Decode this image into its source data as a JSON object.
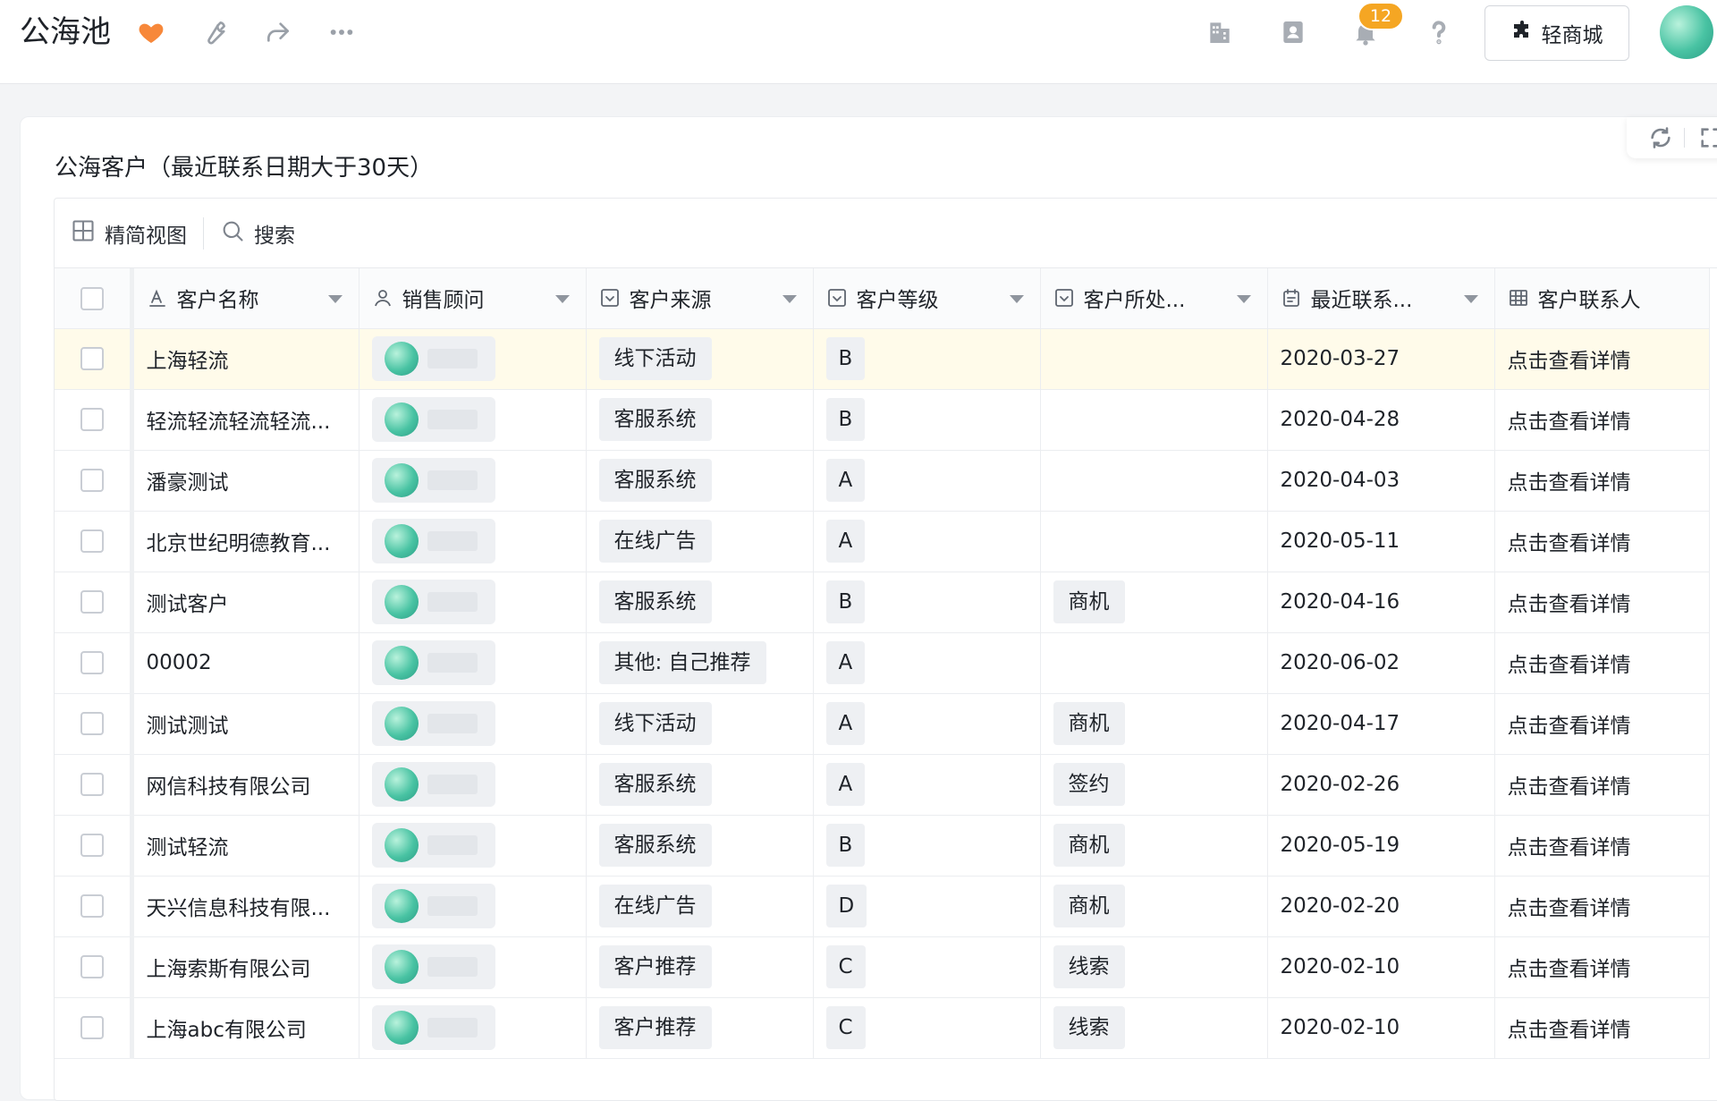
{
  "header": {
    "title": "公海池",
    "notification_count": "12",
    "shop_label": "轻商城"
  },
  "card": {
    "title": "公海客户（最近联系日期大于30天）"
  },
  "toolbar": {
    "view_label": "精简视图",
    "search_label": "搜索"
  },
  "table": {
    "columns": [
      {
        "label": "客户名称",
        "icon": "text-field-icon"
      },
      {
        "label": "销售顾问",
        "icon": "person-field-icon"
      },
      {
        "label": "客户来源",
        "icon": "select-field-icon"
      },
      {
        "label": "客户等级",
        "icon": "select-field-icon"
      },
      {
        "label": "客户所处...",
        "icon": "select-field-icon"
      },
      {
        "label": "最近联系...",
        "icon": "date-field-icon"
      },
      {
        "label": "客户联系人",
        "icon": "table-field-icon"
      }
    ],
    "rows": [
      {
        "name": "上海轻流",
        "source": "线下活动",
        "grade": "B",
        "stage": "",
        "date": "2020-03-27",
        "contact": "点击查看详情"
      },
      {
        "name": "轻流轻流轻流轻流...",
        "source": "客服系统",
        "grade": "B",
        "stage": "",
        "date": "2020-04-28",
        "contact": "点击查看详情"
      },
      {
        "name": "潘豪测试",
        "source": "客服系统",
        "grade": "A",
        "stage": "",
        "date": "2020-04-03",
        "contact": "点击查看详情"
      },
      {
        "name": "北京世纪明德教育...",
        "source": "在线广告",
        "grade": "A",
        "stage": "",
        "date": "2020-05-11",
        "contact": "点击查看详情"
      },
      {
        "name": "测试客户",
        "source": "客服系统",
        "grade": "B",
        "stage": "商机",
        "date": "2020-04-16",
        "contact": "点击查看详情"
      },
      {
        "name": "00002",
        "source": "其他: 自己推荐",
        "grade": "A",
        "stage": "",
        "date": "2020-06-02",
        "contact": "点击查看详情"
      },
      {
        "name": "测试测试",
        "source": "线下活动",
        "grade": "A",
        "stage": "商机",
        "date": "2020-04-17",
        "contact": "点击查看详情"
      },
      {
        "name": "网信科技有限公司",
        "source": "客服系统",
        "grade": "A",
        "stage": "签约",
        "date": "2020-02-26",
        "contact": "点击查看详情"
      },
      {
        "name": "测试轻流",
        "source": "客服系统",
        "grade": "B",
        "stage": "商机",
        "date": "2020-05-19",
        "contact": "点击查看详情"
      },
      {
        "name": "天兴信息科技有限...",
        "source": "在线广告",
        "grade": "D",
        "stage": "商机",
        "date": "2020-02-20",
        "contact": "点击查看详情"
      },
      {
        "name": "上海索斯有限公司",
        "source": "客户推荐",
        "grade": "C",
        "stage": "线索",
        "date": "2020-02-10",
        "contact": "点击查看详情"
      },
      {
        "name": "上海abc有限公司",
        "source": "客户推荐",
        "grade": "C",
        "stage": "线索",
        "date": "2020-02-10",
        "contact": "点击查看详情"
      }
    ]
  },
  "colors": {
    "accent_heart": "#f7883a",
    "badge": "#f5a623",
    "highlight_row": "#fffbea",
    "tag_bg": "#eef0f3"
  }
}
